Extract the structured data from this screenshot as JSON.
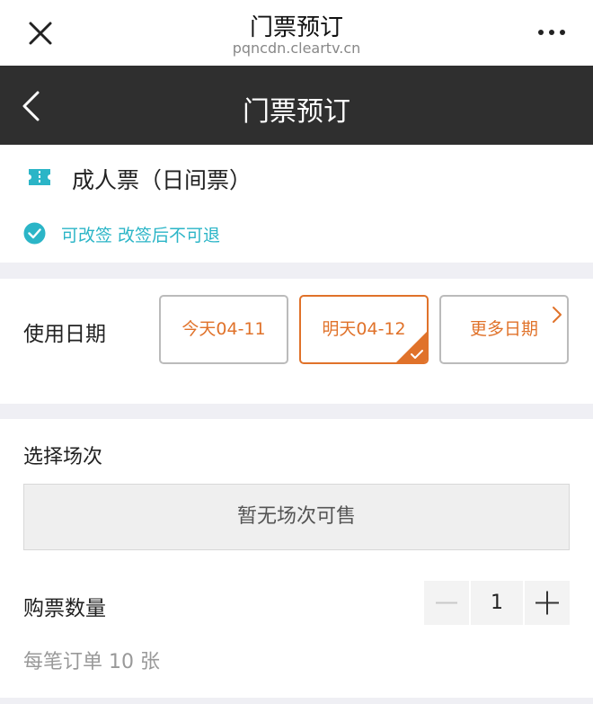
{
  "top_bar": {
    "title": "门票预订",
    "domain": "pqncdn.cleartv.cn",
    "close_icon": "close-icon",
    "more_icon": "more-icon"
  },
  "nav_bar": {
    "title": "门票预订",
    "back_icon": "chevron-left-icon"
  },
  "ticket": {
    "icon": "ticket-icon",
    "name": "成人票（日间票）",
    "policy_icon": "check-circle-icon",
    "policy": "可改签 改签后不可退"
  },
  "date": {
    "label": "使用日期",
    "options": [
      {
        "label": "今天04-11",
        "selected": false
      },
      {
        "label": "明天04-12",
        "selected": true
      },
      {
        "label": "更多日期",
        "selected": false
      }
    ]
  },
  "session": {
    "label": "选择场次",
    "empty": "暂无场次可售"
  },
  "quantity": {
    "label": "购票数量",
    "value": "1",
    "limit": "每笔订单 10 张"
  },
  "colors": {
    "accent": "#e0722a",
    "teal": "#2bb5c7",
    "nav_bg": "#2f2f2f"
  }
}
